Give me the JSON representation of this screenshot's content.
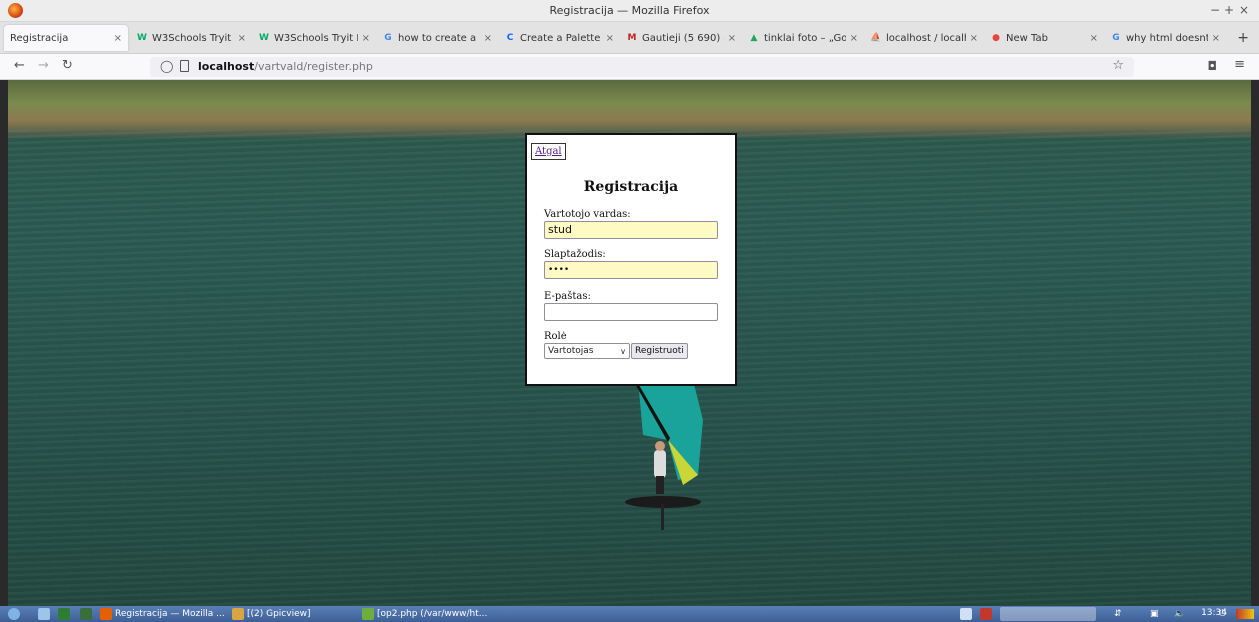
{
  "window": {
    "title": "Registracija — Mozilla Firefox",
    "controls": [
      "−",
      "+",
      "×"
    ]
  },
  "tabs": [
    {
      "label": "Registracija",
      "icon": "",
      "active": true
    },
    {
      "label": "W3Schools Tryit Ed",
      "icon": "W",
      "color": "#04aa6d"
    },
    {
      "label": "W3Schools Tryit Ed",
      "icon": "W",
      "color": "#04aa6d"
    },
    {
      "label": "how to create a ran",
      "icon": "G",
      "color": "#4285f4"
    },
    {
      "label": "Create a Palette - C",
      "icon": "C",
      "color": "#0a66ff"
    },
    {
      "label": "Gautieji (5 690) - m",
      "icon": "M",
      "color": "#c5221f"
    },
    {
      "label": "tinklai foto – „Goo",
      "icon": "▲",
      "color": "#1fa463"
    },
    {
      "label": "localhost / localhos",
      "icon": "⛵",
      "color": "#f29111"
    },
    {
      "label": "New Tab",
      "icon": "●",
      "color": "#e8453c"
    },
    {
      "label": "why html doesnt sh",
      "icon": "G",
      "color": "#4285f4"
    }
  ],
  "nav": {
    "url_host": "localhost",
    "url_path": "/vartvald/register.php"
  },
  "form": {
    "back_link": "Atgal",
    "heading": "Registracija",
    "username_label": "Vartotojo vardas:",
    "username_value": "stud",
    "password_label": "Slaptažodis:",
    "password_value": "••••",
    "email_label": "E-paštas:",
    "email_value": "",
    "role_label": "Rolė",
    "role_selected": "Vartotojas",
    "submit_label": "Registruoti"
  },
  "taskbar": {
    "items": [
      {
        "label": "Registracija — Mozilla ...",
        "color": "#e66000"
      },
      {
        "label": "[(2) Gpicview]",
        "color": "#d9a441"
      },
      {
        "label": "[op2.php (/var/www/ht...",
        "color": "#6fae3d"
      }
    ],
    "clock": "13:34"
  }
}
